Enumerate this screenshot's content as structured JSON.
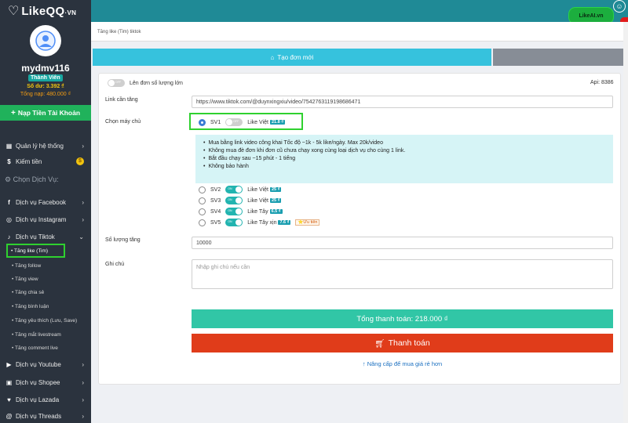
{
  "sidebar": {
    "logo_text": "LikeQQ",
    "logo_suffix": "·VN",
    "username": "mydmv116",
    "member_badge": "Thành Viên",
    "balance": "Số dư: 3.392 ₫",
    "total_deposit": "Tổng nạp: 480.000 ₫",
    "deposit_button": "Nạp Tiền Tài Khoản",
    "menu": {
      "system": "Quản lý hệ thống",
      "earn": "Kiếm tiền",
      "section": "Chọn Dịch Vụ:",
      "facebook": "Dịch vụ Facebook",
      "instagram": "Dịch vụ Instagram",
      "tiktok": "Dịch vụ Tiktok",
      "youtube": "Dịch vụ Youtube",
      "shopee": "Dịch vụ Shopee",
      "lazada": "Dịch vụ Lazada",
      "threads": "Dịch vụ Threads"
    },
    "tiktok_sub": [
      "Tăng like (Tim)",
      "Tăng follow",
      "Tăng view",
      "Tăng chia sẻ",
      "Tăng bình luận",
      "Tăng yêu thích (Lưu, Save)",
      "Tăng mắt livestream",
      "Tăng comment live"
    ]
  },
  "topbar": {
    "likeai_label": "LikeAI.vn"
  },
  "breadcrumb": "Tăng like (Tim) tiktok",
  "tabs": {
    "create_label": "Tạo đơn mới"
  },
  "form": {
    "bulk_toggle_label": "Lên đơn số lượng lớn",
    "toggle_off_text": "OFF",
    "toggle_on_text": "ON",
    "api_label": "Api: 8386",
    "link_label": "Link cần tăng",
    "link_value": "https://www.tiktok.com/@duynxingxiu/video/7542763119198686471",
    "server_label": "Chọn máy chủ",
    "servers": [
      {
        "name": "SV1",
        "desc": "Like Việt",
        "price": "21.8 ₫",
        "selected": true
      },
      {
        "name": "SV2",
        "desc": "Like Việt",
        "price": "25 ₫",
        "selected": false
      },
      {
        "name": "SV3",
        "desc": "Like Việt",
        "price": "25 ₫",
        "selected": false
      },
      {
        "name": "SV4",
        "desc": "Like Tây",
        "price": "6.5 ₫",
        "selected": false
      },
      {
        "name": "SV5",
        "desc": "Like Tây xịn",
        "price": "7.6 ₫",
        "selected": false,
        "priority": "Ưu tiên"
      }
    ],
    "info": [
      "Mua bằng link video công khai Tốc độ ~1k - 5k  like/ngày. Max 20k/video",
      "Không mua đè đơn khi đơn cũ chưa chạy xong cùng loại dịch vụ cho cùng 1 link.",
      "Bắt đầu chạy sau ~15 phút - 1 tiếng",
      "Không bảo hành"
    ],
    "quantity_label": "Số lượng tăng",
    "quantity_value": "10000",
    "note_label": "Ghi chú",
    "note_placeholder": "Nhập ghi chú nếu cần",
    "total_button": "Tổng thanh toán: 218.000  ₫",
    "pay_button": "Thanh toán",
    "upgrade_link": "Nâng cấp để mua giá rẻ hơn"
  },
  "colors": {
    "sidebar_bg": "#2b333e",
    "topbar_bg": "#1f8a96",
    "tab_active": "#36c2dd",
    "total_btn": "#31c6a6",
    "pay_btn": "#e03c1a",
    "deposit_btn": "#20b25b",
    "highlight": "#2fd12f"
  }
}
